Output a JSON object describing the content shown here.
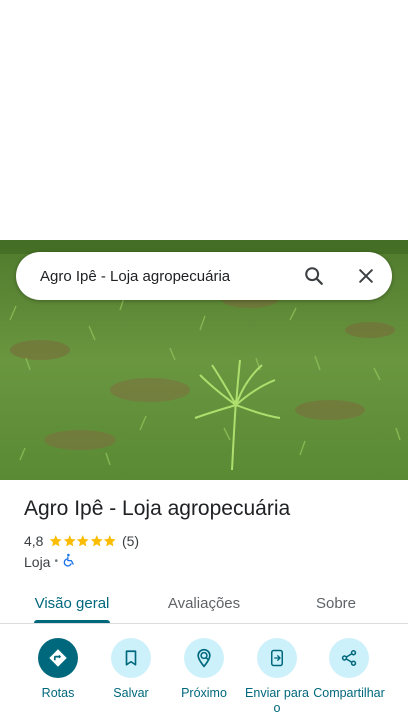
{
  "search": {
    "query": "Agro Ipê - Loja agropecuária"
  },
  "place": {
    "name": "Agro Ipê - Loja agropecuária",
    "rating": "4,8",
    "star_count": 5,
    "review_count": "(5)",
    "category": "Loja",
    "separator": "•",
    "accessibility_icon": "wheelchair-icon"
  },
  "tabs": [
    {
      "label": "Visão geral",
      "active": true
    },
    {
      "label": "Avaliações",
      "active": false
    },
    {
      "label": "Sobre",
      "active": false
    }
  ],
  "actions": [
    {
      "label": "Rotas",
      "icon": "directions-icon"
    },
    {
      "label": "Salvar",
      "icon": "bookmark-icon"
    },
    {
      "label": "Próximo",
      "icon": "nearby-icon"
    },
    {
      "label": "Enviar para o",
      "icon": "send-to-phone-icon"
    },
    {
      "label": "Compartilhar",
      "icon": "share-icon"
    }
  ],
  "colors": {
    "accent": "#00687c",
    "action_bg": "#cdf1fb",
    "star": "#fbbc04",
    "grass": "#5f8a38"
  }
}
